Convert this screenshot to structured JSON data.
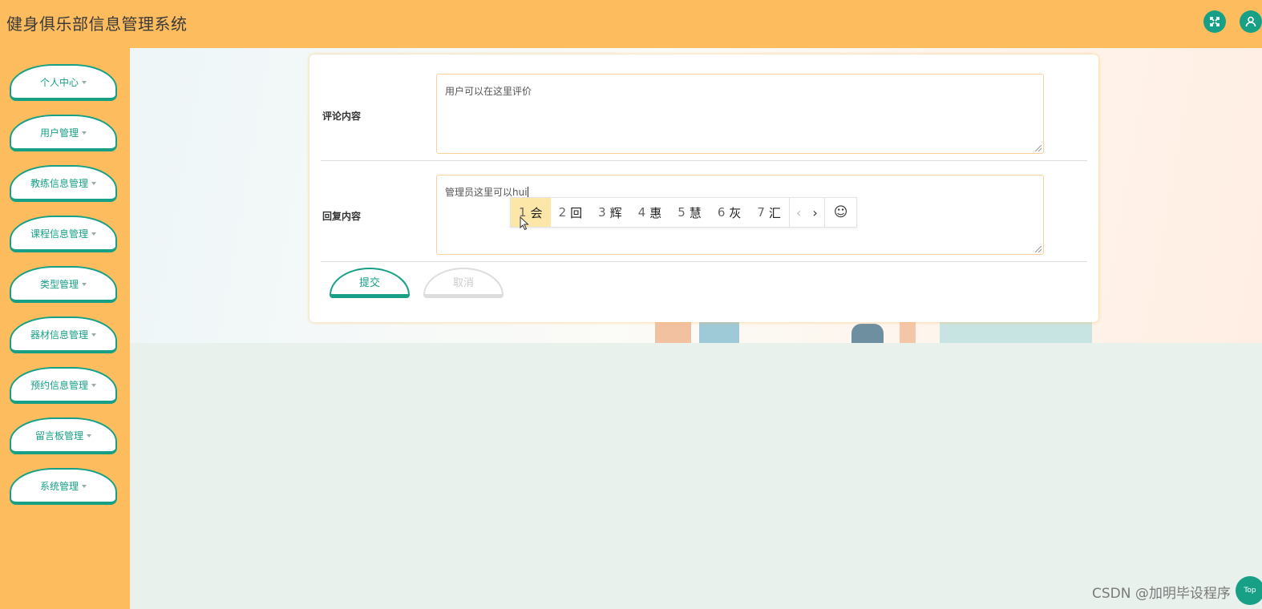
{
  "app": {
    "title": "健身俱乐部信息管理系统"
  },
  "topbar": {
    "fullscreen_icon": "expand-icon",
    "user_icon": "user-icon",
    "accent_color": "#fdbd5e",
    "button_color": "#17a086"
  },
  "sidebar": {
    "items": [
      {
        "label": "个人中心"
      },
      {
        "label": "用户管理"
      },
      {
        "label": "教练信息管理"
      },
      {
        "label": "课程信息管理"
      },
      {
        "label": "类型管理"
      },
      {
        "label": "器材信息管理"
      },
      {
        "label": "预约信息管理"
      },
      {
        "label": "留言板管理"
      },
      {
        "label": "系统管理"
      }
    ]
  },
  "form": {
    "comment": {
      "label": "评论内容",
      "value": "用户可以在这里评价"
    },
    "reply": {
      "label": "回复内容",
      "value_prefix": "管理员这里可以",
      "composing": "hui"
    },
    "submit_label": "提交",
    "cancel_label": "取消"
  },
  "ime": {
    "candidates": [
      {
        "num": "1",
        "text": "会"
      },
      {
        "num": "2",
        "text": "回"
      },
      {
        "num": "3",
        "text": "辉"
      },
      {
        "num": "4",
        "text": "惠"
      },
      {
        "num": "5",
        "text": "慧"
      },
      {
        "num": "6",
        "text": "灰"
      },
      {
        "num": "7",
        "text": "汇"
      }
    ],
    "prev": "‹",
    "next": "›",
    "emoji": "☺"
  },
  "footer": {
    "watermark": "CSDN @加明毕设程序",
    "top_button": "Top"
  }
}
